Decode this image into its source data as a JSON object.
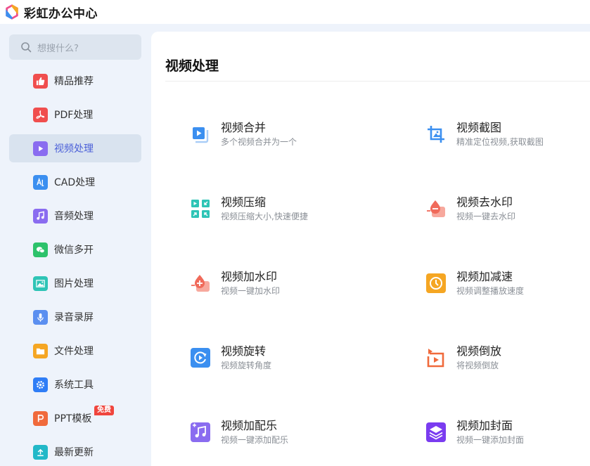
{
  "app": {
    "title": "彩虹办公中心"
  },
  "search": {
    "placeholder": "想搜什么?"
  },
  "sidebar": {
    "items": [
      {
        "label": "精品推荐",
        "icon": "thumbs-up-icon",
        "color": "#f04e4e"
      },
      {
        "label": "PDF处理",
        "icon": "pdf-icon",
        "color": "#f04e4e"
      },
      {
        "label": "视频处理",
        "icon": "video-play-icon",
        "color": "#8a6cf0",
        "active": true
      },
      {
        "label": "CAD处理",
        "icon": "cad-icon",
        "color": "#3b8ff0"
      },
      {
        "label": "音频处理",
        "icon": "music-note-icon",
        "color": "#8a6cf0"
      },
      {
        "label": "微信多开",
        "icon": "wechat-icon",
        "color": "#2dc26b"
      },
      {
        "label": "图片处理",
        "icon": "image-icon",
        "color": "#2ec4b6"
      },
      {
        "label": "录音录屏",
        "icon": "microphone-icon",
        "color": "#5b8ff0"
      },
      {
        "label": "文件处理",
        "icon": "folder-icon",
        "color": "#f5a623"
      },
      {
        "label": "系统工具",
        "icon": "gear-icon",
        "color": "#2f7df6"
      },
      {
        "label": "PPT模板",
        "icon": "ppt-icon",
        "color": "#f06a3c",
        "badge": "免费"
      },
      {
        "label": "最新更新",
        "icon": "upload-arrow-icon",
        "color": "#22b8c8"
      }
    ]
  },
  "main": {
    "title": "视频处理",
    "tools": [
      {
        "name": "视频合并",
        "desc": "多个视频合并为一个",
        "icon": "video-merge-icon",
        "color": "#3b8ff0"
      },
      {
        "name": "视频截图",
        "desc": "精准定位视频,获取截图",
        "icon": "crop-icon",
        "color": "#3b8ff0"
      },
      {
        "name": "视频压缩",
        "desc": "视频压缩大小,快速便捷",
        "icon": "compress-icon",
        "color": "#2ec4b6"
      },
      {
        "name": "视频去水印",
        "desc": "视频一键去水印",
        "icon": "remove-watermark-icon",
        "color": "#f06a5a"
      },
      {
        "name": "视频加水印",
        "desc": "视频一键加水印",
        "icon": "add-watermark-icon",
        "color": "#f06a5a"
      },
      {
        "name": "视频加减速",
        "desc": "视频调整播放速度",
        "icon": "speed-icon",
        "color": "#f5a623"
      },
      {
        "name": "视频旋转",
        "desc": "视频旋转角度",
        "icon": "rotate-icon",
        "color": "#3b8ff0"
      },
      {
        "name": "视频倒放",
        "desc": "将视频倒放",
        "icon": "reverse-icon",
        "color": "#f06a3c"
      },
      {
        "name": "视频加配乐",
        "desc": "视频一键添加配乐",
        "icon": "add-music-icon",
        "color": "#8a6cf0"
      },
      {
        "name": "视频加封面",
        "desc": "视频一键添加封面",
        "icon": "add-cover-icon",
        "color": "#7a3cf0"
      }
    ]
  }
}
